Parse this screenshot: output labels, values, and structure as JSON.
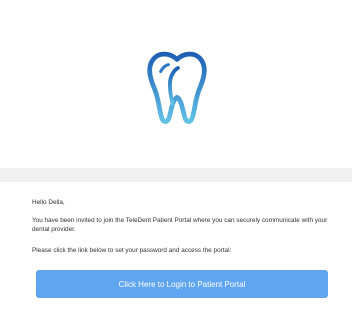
{
  "branding": {
    "logo_icon": "tooth-icon",
    "accent_color": "#5fa5ef"
  },
  "email": {
    "greeting": "Hello Della,",
    "paragraph1": "You have been invited to join the TeleDent Patient Portal where you can securely communicate with your dental provider.",
    "paragraph2": "Please click the link below to set your password and access the portal:",
    "cta_label": "Click Here to Login to Patient Portal"
  }
}
